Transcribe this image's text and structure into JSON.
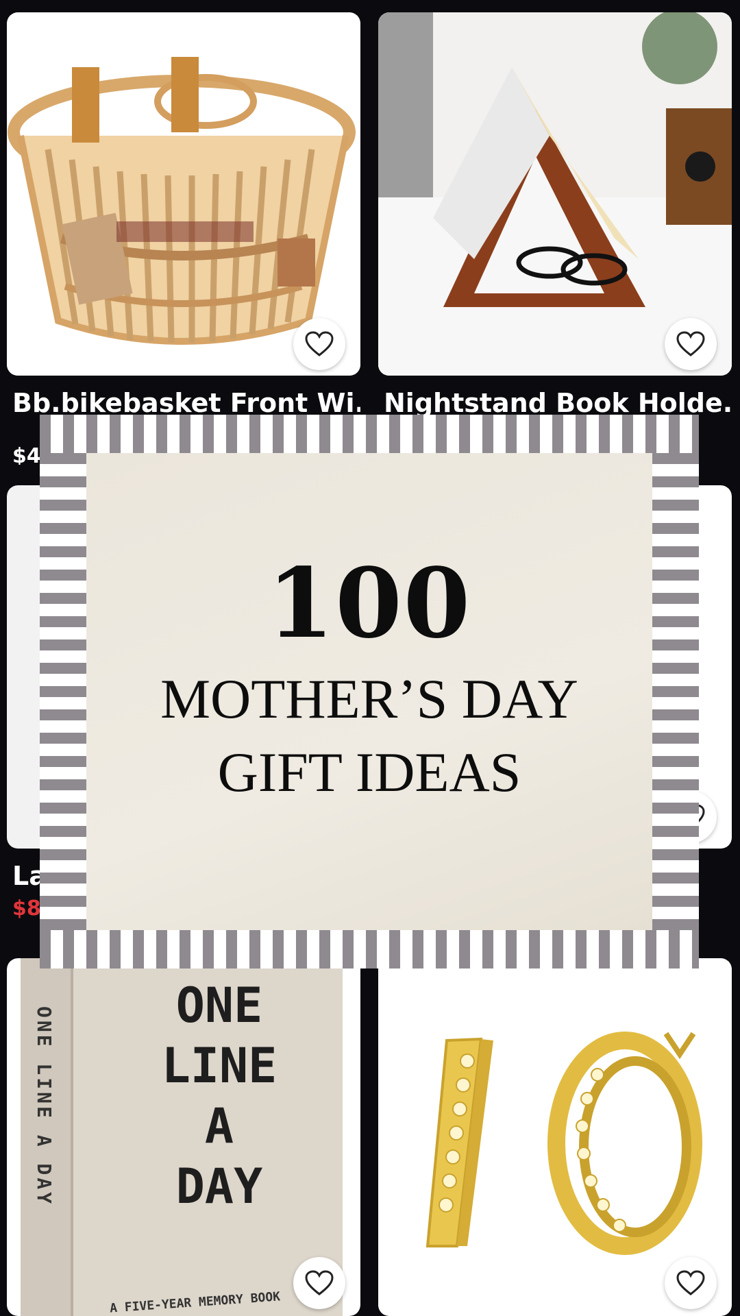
{
  "products": [
    {
      "title": "Bb.bikebasket Front Wi...",
      "price": "$4",
      "price_color": "#ffffff",
      "image": "wicker-bike-basket"
    },
    {
      "title": "Nightstand Book Holde...",
      "price": "",
      "price_color": "#ffffff",
      "image": "wooden-book-holder"
    },
    {
      "title": "La",
      "price": "$8",
      "price_color": "#e0353b",
      "image": "hidden-product"
    },
    {
      "title": "",
      "price": "",
      "price_color": "#ffffff",
      "image": "hidden-product"
    },
    {
      "title": "",
      "price": "",
      "price_color": "#ffffff",
      "image": "one-line-a-day-journal"
    },
    {
      "title": "",
      "price": "",
      "price_color": "#ffffff",
      "image": "gold-hoop-earrings"
    }
  ],
  "book": {
    "cover_lines": [
      "ONE",
      "LINE",
      "A",
      "DAY"
    ],
    "spine": "ONE LINE A DAY",
    "subtitle": "A FIVE-YEAR MEMORY BOOK"
  },
  "banner": {
    "number": "100",
    "line1": "MOTHER’S DAY",
    "line2": "GIFT IDEAS",
    "stripe_color": "#8f8a8f"
  }
}
